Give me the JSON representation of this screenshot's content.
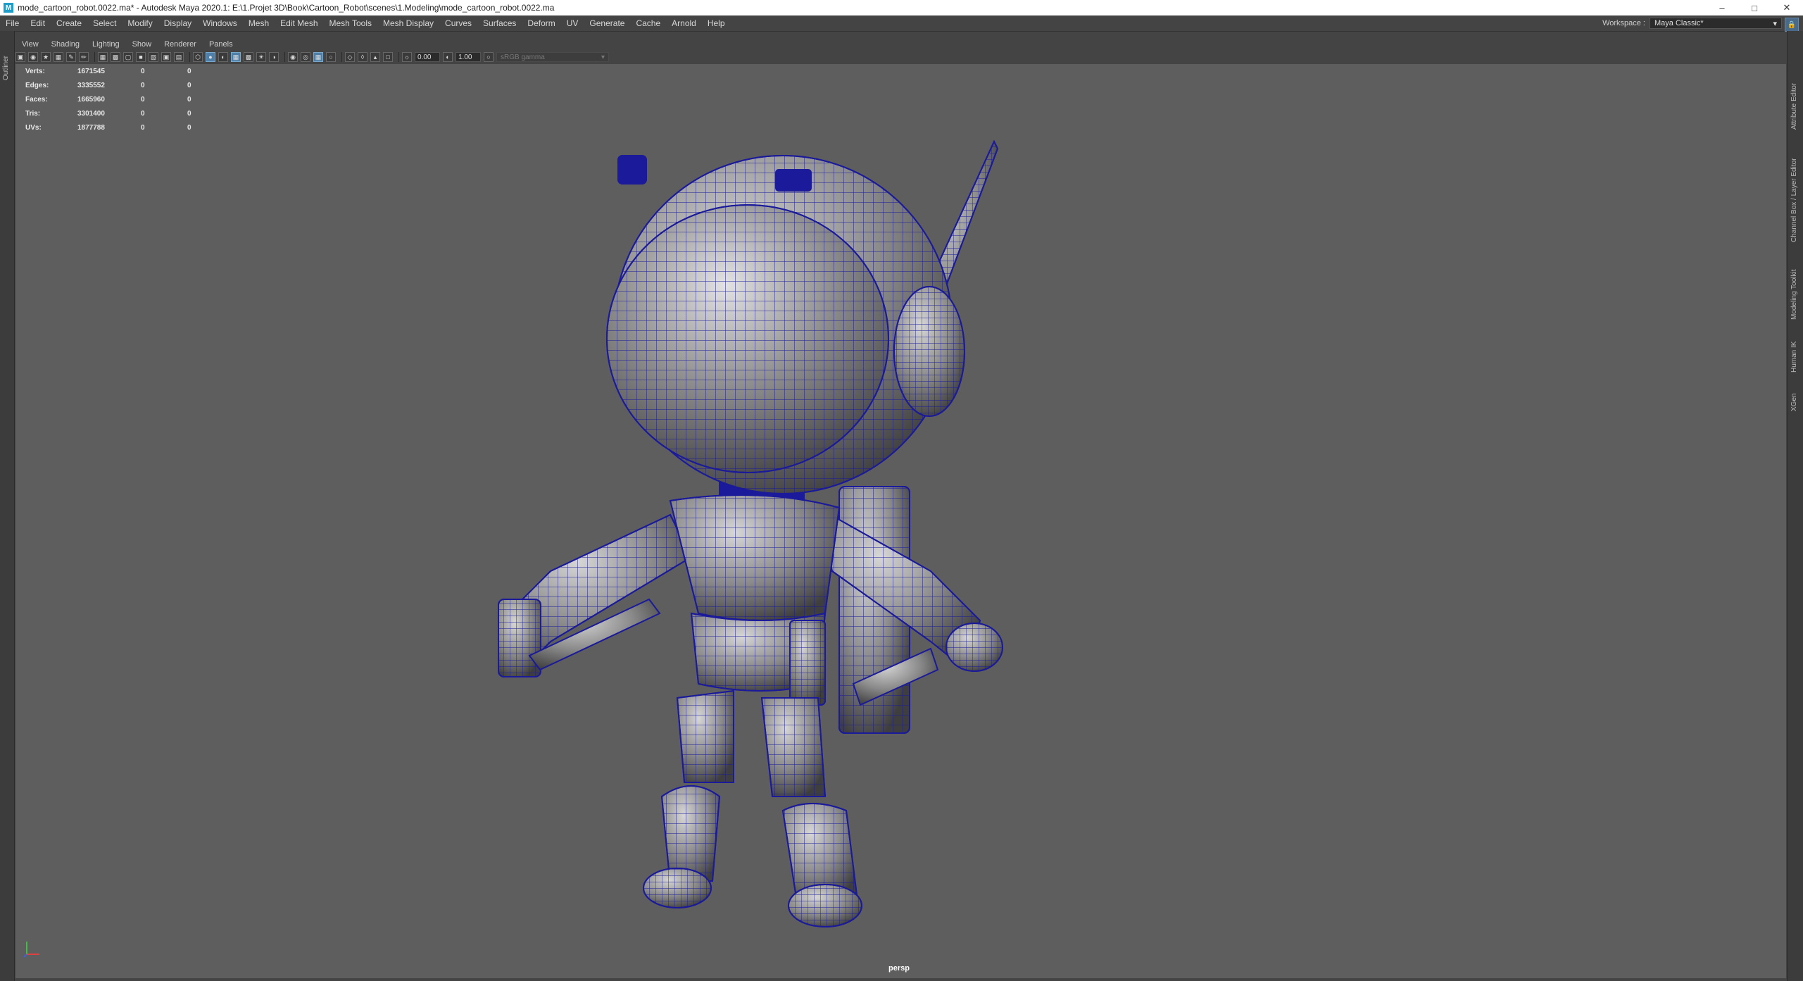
{
  "window": {
    "title": "mode_cartoon_robot.0022.ma* - Autodesk Maya 2020.1: E:\\1.Projet 3D\\Book\\Cartoon_Robot\\scenes\\1.Modeling\\mode_cartoon_robot.0022.ma",
    "app_icon": "M",
    "controls": [
      "–",
      "□",
      "✕"
    ]
  },
  "menubar": {
    "items": [
      "File",
      "Edit",
      "Create",
      "Select",
      "Modify",
      "Display",
      "Windows",
      "Mesh",
      "Edit Mesh",
      "Mesh Tools",
      "Mesh Display",
      "Curves",
      "Surfaces",
      "Deform",
      "UV",
      "Generate",
      "Cache",
      "Arnold",
      "Help"
    ]
  },
  "workspace": {
    "label": "Workspace :",
    "value": "Maya Classic*"
  },
  "left_tabs": {
    "outliner": "Outliner"
  },
  "right_tabs": [
    "Attribute Editor",
    "Channel Box / Layer Editor",
    "Modeling Toolkit",
    "Human IK",
    "XGen"
  ],
  "panel_menu": [
    "View",
    "Shading",
    "Lighting",
    "Show",
    "Renderer",
    "Panels"
  ],
  "toolbar": {
    "exposure": "0.00",
    "gamma": "1.00",
    "color_space": "sRGB gamma"
  },
  "hud": {
    "rows": [
      {
        "label": "Verts:",
        "v1": "1671545",
        "v2": "0",
        "v3": "0"
      },
      {
        "label": "Edges:",
        "v1": "3335552",
        "v2": "0",
        "v3": "0"
      },
      {
        "label": "Faces:",
        "v1": "1665960",
        "v2": "0",
        "v3": "0"
      },
      {
        "label": "Tris:",
        "v1": "3301400",
        "v2": "0",
        "v3": "0"
      },
      {
        "label": "UVs:",
        "v1": "1877788",
        "v2": "0",
        "v3": "0"
      }
    ]
  },
  "viewport": {
    "camera": "persp"
  },
  "colors": {
    "wireframe": "#1a1a9a",
    "viewport_bg": "#5e5e5e",
    "accent": "#4d7fa8"
  }
}
